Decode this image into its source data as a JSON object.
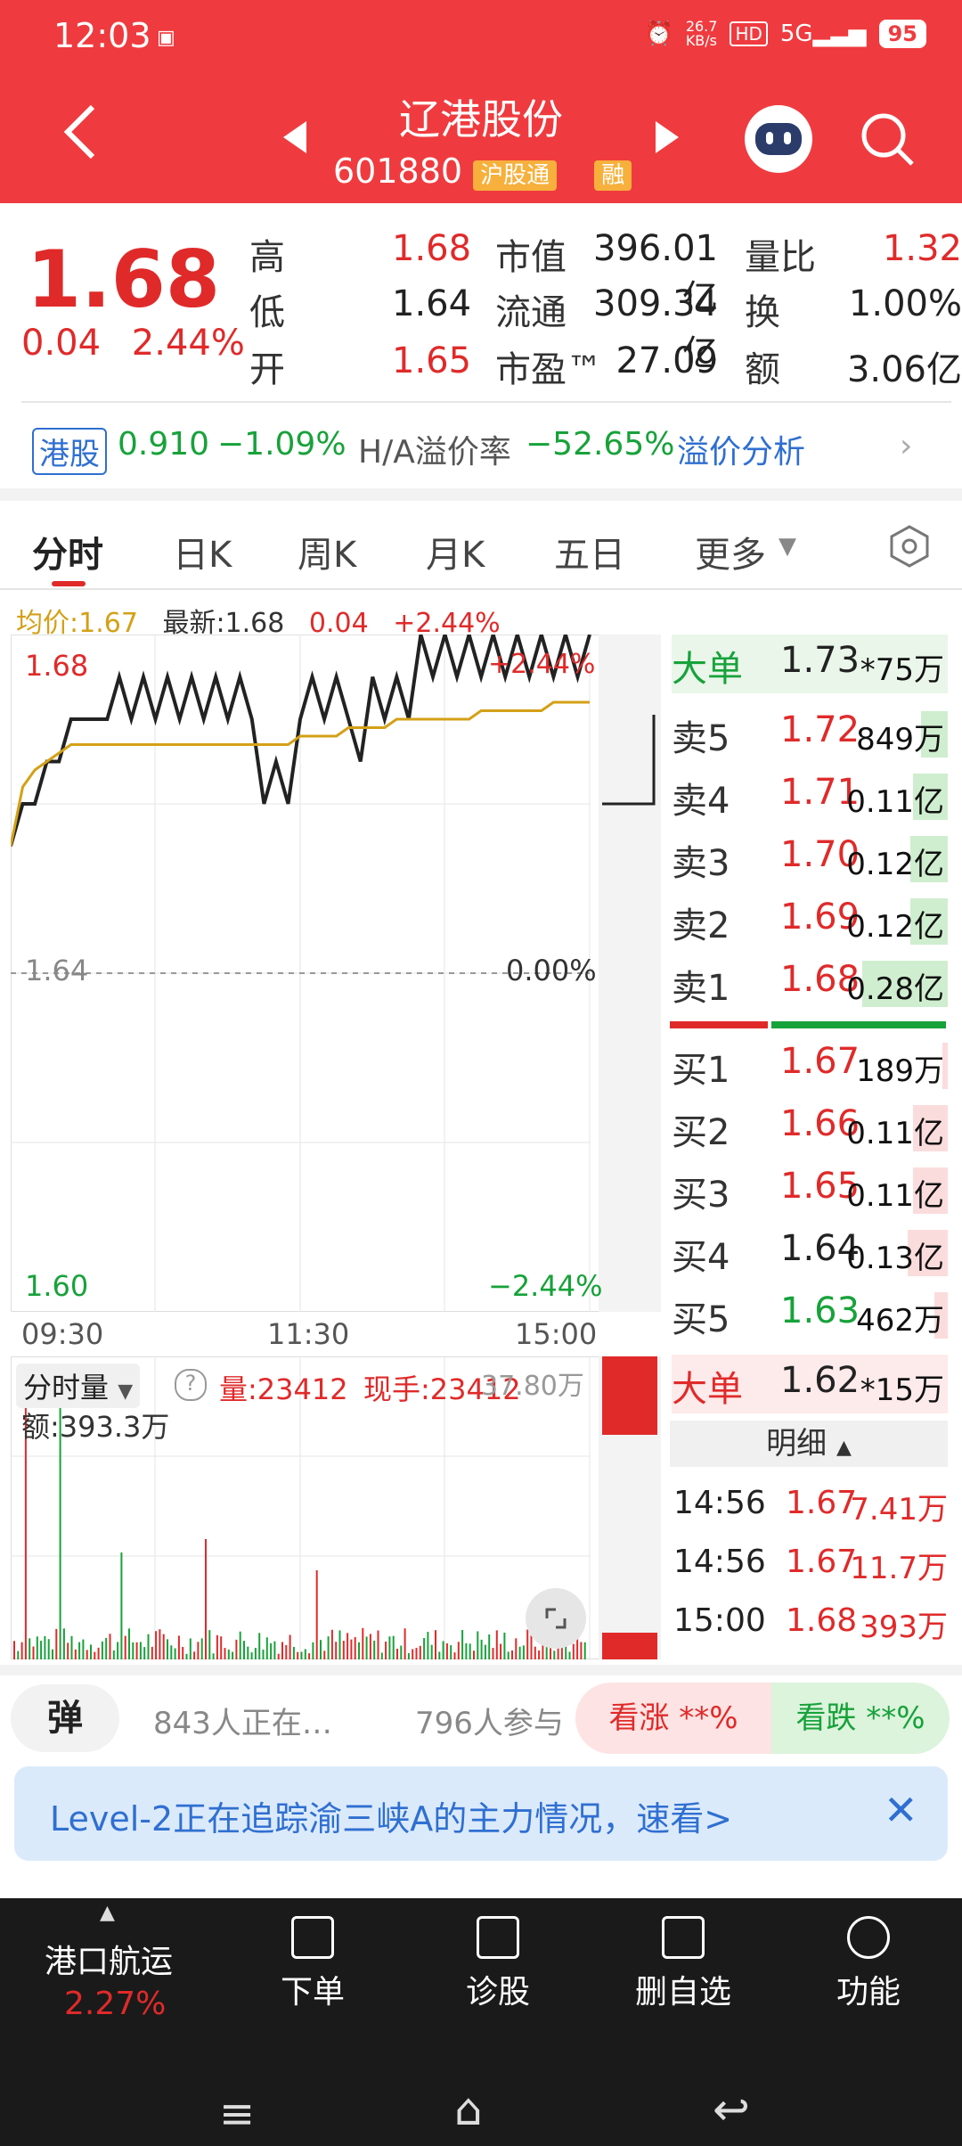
{
  "status_bar": {
    "time": "12:03",
    "net_speed": "26.7\nKB/s",
    "hd": "HD",
    "signal": "5G",
    "battery": "95"
  },
  "header": {
    "title": "辽港股份",
    "code": "601880",
    "tag1": "沪股通",
    "tag2": "融"
  },
  "quote": {
    "price": "1.68",
    "change": "0.04",
    "change_pct": "2.44%",
    "rows": [
      {
        "l1": "高",
        "v1": "1.68",
        "l2": "市值",
        "v2": "396.01亿",
        "l3": "量比",
        "v3": "1.32"
      },
      {
        "l1": "低",
        "v1": "1.64",
        "l2": "流通",
        "v2": "309.34亿",
        "l3": "换",
        "v3": "1.00%"
      },
      {
        "l1": "开",
        "v1": "1.65",
        "l2": "市盈™",
        "v2": "27.09",
        "l3": "额",
        "v3": "3.06亿"
      }
    ]
  },
  "hk": {
    "tag": "港股",
    "price": "0.910",
    "pct": "−1.09%",
    "premium_label": "H/A溢价率",
    "premium": "−52.65%",
    "link": "溢价分析"
  },
  "tabs": [
    "分时",
    "日K",
    "周K",
    "月K",
    "五日",
    "更多"
  ],
  "chart_header": {
    "avg": "均价:1.67",
    "latest": "最新:1.68",
    "chg": "0.04",
    "pct": "+2.44%"
  },
  "chart_data": {
    "type": "line",
    "yaxis_labels": {
      "top": "1.68",
      "mid": "1.64",
      "bottom": "1.60"
    },
    "pct_labels": {
      "top": "+2.44%",
      "mid": "0.00%",
      "bottom": "−2.44%"
    },
    "x_ticks": [
      "09:30",
      "11:30",
      "15:00"
    ],
    "ylim": [
      1.6,
      1.68
    ],
    "series": [
      {
        "values": [
          1.655,
          1.66,
          1.66,
          1.665,
          1.665,
          1.67,
          1.67,
          1.67,
          1.67,
          1.675,
          1.67,
          1.675,
          1.67,
          1.675,
          1.67,
          1.675,
          1.67,
          1.675,
          1.67,
          1.675,
          1.67,
          1.66,
          1.665,
          1.66,
          1.67,
          1.675,
          1.67,
          1.675,
          1.67,
          1.665,
          1.675,
          1.67,
          1.675,
          1.67,
          1.68,
          1.675,
          1.68,
          1.675,
          1.68,
          1.675,
          1.68,
          1.675,
          1.68,
          1.675,
          1.68,
          1.675,
          1.68,
          1.675,
          1.68
        ]
      },
      {
        "values": [
          1.655,
          1.662,
          1.664,
          1.665,
          1.666,
          1.667,
          1.667,
          1.667,
          1.667,
          1.667,
          1.667,
          1.667,
          1.667,
          1.667,
          1.667,
          1.667,
          1.667,
          1.667,
          1.667,
          1.667,
          1.667,
          1.667,
          1.667,
          1.667,
          1.668,
          1.668,
          1.668,
          1.668,
          1.669,
          1.669,
          1.669,
          1.669,
          1.67,
          1.67,
          1.67,
          1.67,
          1.67,
          1.67,
          1.67,
          1.671,
          1.671,
          1.671,
          1.671,
          1.671,
          1.671,
          1.672,
          1.672,
          1.672,
          1.672
        ]
      }
    ]
  },
  "volume": {
    "selector": "分时量",
    "vol": "量:23412",
    "now": "现手:23412",
    "max": "37.80万",
    "amount": "额:393.3万"
  },
  "orderbook": {
    "big_sell": {
      "label": "大单",
      "price": "1.73",
      "vol": "*75万"
    },
    "asks": [
      {
        "label": "卖5",
        "price": "1.72",
        "vol": "849万",
        "fill": 0.1
      },
      {
        "label": "卖4",
        "price": "1.71",
        "vol": "0.11亿",
        "fill": 0.13
      },
      {
        "label": "卖3",
        "price": "1.70",
        "vol": "0.12亿",
        "fill": 0.14
      },
      {
        "label": "卖2",
        "price": "1.69",
        "vol": "0.12亿",
        "fill": 0.14
      },
      {
        "label": "卖1",
        "price": "1.68",
        "vol": "0.28亿",
        "fill": 0.32
      }
    ],
    "bids": [
      {
        "label": "买1",
        "price": "1.67",
        "vol": "189万",
        "fill": 0.02
      },
      {
        "label": "买2",
        "price": "1.66",
        "vol": "0.11亿",
        "fill": 0.13
      },
      {
        "label": "买3",
        "price": "1.65",
        "vol": "0.11亿",
        "fill": 0.13
      },
      {
        "label": "买4",
        "price": "1.64",
        "vol": "0.13亿",
        "fill": 0.15
      },
      {
        "label": "买5",
        "price": "1.63",
        "vol": "462万",
        "fill": 0.05
      }
    ],
    "big_buy": {
      "label": "大单",
      "price": "1.62",
      "vol": "*15万"
    }
  },
  "detail": {
    "title": "明细",
    "rows": [
      {
        "time": "14:56",
        "price": "1.67",
        "amt": "7.41万"
      },
      {
        "time": "14:56",
        "price": "1.67",
        "amt": "11.7万"
      },
      {
        "time": "15:00",
        "price": "1.68",
        "amt": "393万"
      }
    ]
  },
  "social": {
    "danmu": "弹",
    "watching": "843人正在…",
    "participants": "796人参与",
    "up": "看涨 **%",
    "down": "看跌 **%"
  },
  "banner": {
    "text": "Level-2正在追踪渝三峡A的主力情况，速看>"
  },
  "bottom_nav": {
    "sector": "港口航运",
    "sector_pct": "2.27%",
    "items": [
      "下单",
      "诊股",
      "删自选",
      "功能"
    ]
  }
}
